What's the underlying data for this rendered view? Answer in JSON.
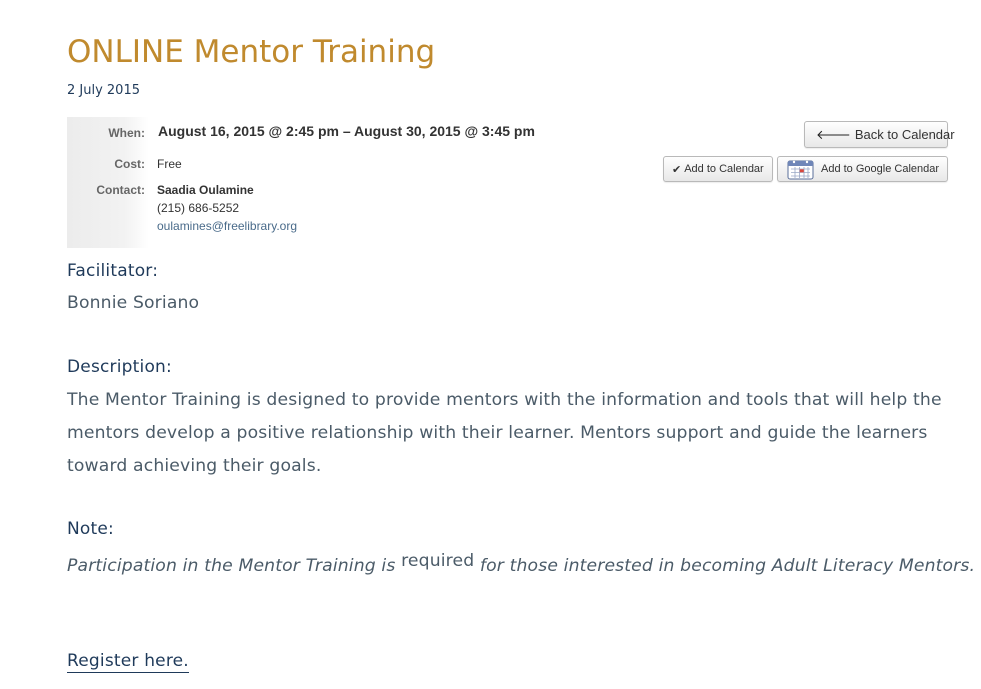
{
  "page": {
    "title": "ONLINE Mentor Training",
    "date": "2 July 2015"
  },
  "event": {
    "when_label": "When:",
    "when_value": "August 16, 2015 @ 2:45 pm – August 30, 2015 @ 3:45 pm",
    "cost_label": "Cost:",
    "cost_value": "Free",
    "contact_label": "Contact:",
    "contact_name": "Saadia Oulamine",
    "contact_phone": "(215) 686-5252",
    "contact_email": "oulamines@freelibrary.org"
  },
  "buttons": {
    "back_label": "Back to Calendar",
    "back_icon": "arrow-left-icon",
    "ical_label": "Add to Calendar",
    "ical_icon": "checkmark-icon",
    "gcal_label": "Add to Google Calendar",
    "gcal_icon": "calendar-icon"
  },
  "facilitator": {
    "heading": "Facilitator:",
    "name": "Bonnie Soriano"
  },
  "description": {
    "heading": "Description:",
    "text": "The Mentor Training is designed to provide mentors with the information and tools that will help the mentors develop a positive relationship with their learner.  Mentors support and guide the learners toward achieving their goals."
  },
  "note": {
    "heading": "Note:",
    "text_before": "Participation in the Mentor Training is ",
    "required": "required",
    "text_after": " for those interested in becoming Adult Literacy Mentors."
  },
  "register": {
    "label": "Register here."
  },
  "colors": {
    "title": "#c08a2e",
    "heading": "#1f3a5a",
    "body_text": "#4b5b68"
  }
}
